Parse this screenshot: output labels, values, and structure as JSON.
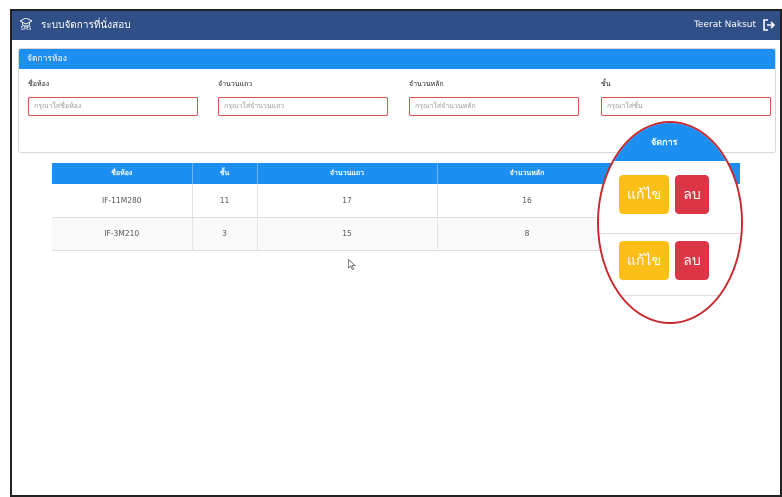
{
  "app": {
    "brand_icon_label": "SMS",
    "title": "ระบบจัดการที่นั่งสอบ",
    "user_name": "Teerat Naksut"
  },
  "card": {
    "header": "จัดการห้อง",
    "fields": [
      {
        "label": "ชื่อห้อง",
        "placeholder": "กรุณาใส่ชื่อห้อง"
      },
      {
        "label": "จำนวนแถว",
        "placeholder": "กรุณาใส่จำนวนแถว"
      },
      {
        "label": "จำนวนหลัก",
        "placeholder": "กรุณาใส่จำนวนหลัก"
      },
      {
        "label": "ชั้น",
        "placeholder": "กรุณาใส่ชั้น"
      }
    ]
  },
  "table": {
    "headers": [
      "ชื่อห้อง",
      "ชั้น",
      "จำนวนแถว",
      "จำนวนหลัก",
      "จัดการ"
    ],
    "rows": [
      {
        "name": "IF-11M280",
        "floor": "11",
        "rows": "17",
        "cols": "16"
      },
      {
        "name": "IF-3M210",
        "floor": "3",
        "rows": "15",
        "cols": "8"
      }
    ]
  },
  "actions": {
    "edit_label": "แก้ไข",
    "delete_label": "ลบ"
  },
  "colors": {
    "navbar": "#2f4f86",
    "primary": "#1d8ef2",
    "edit": "#fbbf18",
    "delete": "#dc3545",
    "highlight_circle": "#c8282b"
  }
}
